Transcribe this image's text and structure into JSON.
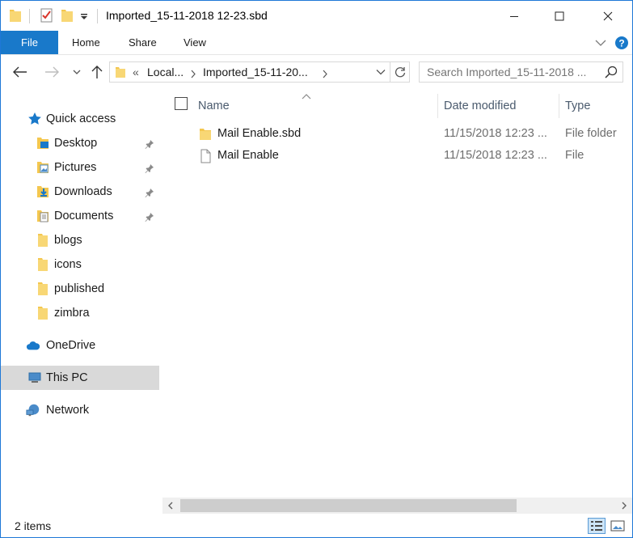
{
  "window": {
    "title": "Imported_15-11-2018 12-23.sbd"
  },
  "ribbon": {
    "tabs": [
      {
        "label": "File"
      },
      {
        "label": "Home"
      },
      {
        "label": "Share"
      },
      {
        "label": "View"
      }
    ]
  },
  "address": {
    "overflow": "«",
    "crumbs": [
      "Local...",
      "Imported_15-11-20..."
    ]
  },
  "search": {
    "placeholder": "Search Imported_15-11-2018 ..."
  },
  "sidebar": {
    "quick_access": "Quick access",
    "items": [
      {
        "label": "Desktop",
        "icon": "desktop-folder-icon",
        "pinned": true
      },
      {
        "label": "Pictures",
        "icon": "pictures-folder-icon",
        "pinned": true
      },
      {
        "label": "Downloads",
        "icon": "downloads-folder-icon",
        "pinned": true
      },
      {
        "label": "Documents",
        "icon": "documents-folder-icon",
        "pinned": true
      },
      {
        "label": "blogs",
        "icon": "folder-icon",
        "pinned": false
      },
      {
        "label": "icons",
        "icon": "folder-icon",
        "pinned": false
      },
      {
        "label": "published",
        "icon": "folder-icon",
        "pinned": false
      },
      {
        "label": "zimbra",
        "icon": "folder-icon",
        "pinned": false
      }
    ],
    "onedrive": "OneDrive",
    "this_pc": "This PC",
    "network": "Network"
  },
  "content": {
    "columns": {
      "name": "Name",
      "date": "Date modified",
      "type": "Type"
    },
    "rows": [
      {
        "name": "Mail Enable.sbd",
        "date": "11/15/2018 12:23 ...",
        "type": "File folder",
        "icon": "folder-icon"
      },
      {
        "name": "Mail Enable",
        "date": "11/15/2018 12:23 ...",
        "type": "File",
        "icon": "file-icon"
      }
    ]
  },
  "status": {
    "items": "2 items"
  },
  "colors": {
    "accent": "#1979ca",
    "folder": "#f4c74f",
    "selection": "#d9d9d9"
  }
}
